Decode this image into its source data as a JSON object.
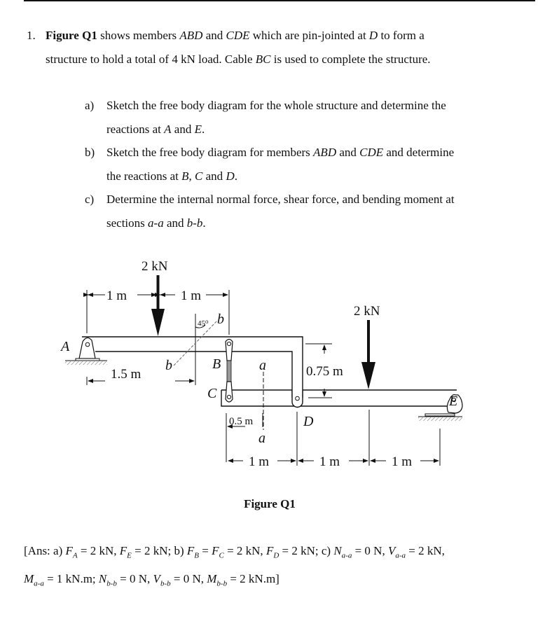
{
  "question": {
    "number": "1.",
    "lead_bold": "Figure Q1",
    "line1_a": " shows members ",
    "member1": "ABD",
    "line1_b": " and ",
    "member2": "CDE",
    "line1_c": " which are pin-jointed at ",
    "joint": "D",
    "line1_d": " to form a",
    "line2_a": "structure to hold a total of 4 kN load. Cable ",
    "cable": "BC",
    "line2_b": " is used to complete the structure."
  },
  "parts": [
    {
      "label": "a)",
      "line1": "Sketch the free body diagram for the whole structure and determine the",
      "line2_a": "reactions  at ",
      "v1": "A",
      "mid": " and ",
      "v2": "E",
      "end": "."
    },
    {
      "label": "b)",
      "line1_a": "Sketch the free body diagram for members ",
      "m1": "ABD",
      "line1_b": " and ",
      "m2": "CDE",
      "line1_c": " and determine",
      "line2_a": "the reactions at ",
      "v1": "B",
      "sep1": ", ",
      "v2": "C",
      "mid": " and ",
      "v3": "D",
      "end": "."
    },
    {
      "label": "c)",
      "line1": "Determine the internal normal force, shear force, and bending moment at",
      "line2_a": "sections ",
      "s1": "a-a",
      "mid": " and ",
      "s2": "b-b",
      "end": "."
    }
  ],
  "figure": {
    "caption": "Figure Q1",
    "loads": [
      "2 kN",
      "2 kN"
    ],
    "dimensions": {
      "a_to_load": "1 m",
      "load_to_B": "1 m",
      "a_to_bb": "1.5 m",
      "angle": "45",
      "angle_unit": "o",
      "height": "0.75 m",
      "c_to_aa": "0.5 m",
      "bottom": [
        "1 m",
        "1 m",
        "1 m"
      ]
    },
    "point_labels": {
      "A": "A",
      "B": "B",
      "C": "C",
      "D": "D",
      "E": "E"
    },
    "section_labels": {
      "a": "a",
      "b": "b"
    }
  },
  "answer": {
    "open": "[Ans: a) ",
    "FA": "F",
    "FA_sub": "A",
    "FA_val": " = 2 kN, ",
    "FE": "F",
    "FE_sub": "E",
    "FE_val": " = 2 kN; b) ",
    "FB": "F",
    "FB_sub": "B",
    "FB_eq": " = ",
    "FC": "F",
    "FC_sub": "C",
    "FC_val": " = 2 kN, ",
    "FD": "F",
    "FD_sub": "D",
    "FD_val": " = 2 kN; c) ",
    "Naa": "N",
    "Naa_sub": "a-a",
    "Naa_val": " = 0 N, ",
    "Vaa": "V",
    "Vaa_sub": "a-a",
    "Vaa_val": " = 2 kN,",
    "Maa": "M",
    "Maa_sub": "a-a",
    "Maa_val": " = 1 kN.m; ",
    "Nbb": "N",
    "Nbb_sub": "b-b",
    "Nbb_val": " = 0 N, ",
    "Vbb": "V",
    "Vbb_sub": "b-b",
    "Vbb_val": " = 0 N, ",
    "Mbb": "M",
    "Mbb_sub": "b-b",
    "Mbb_val": " = 2 kN.m]"
  }
}
